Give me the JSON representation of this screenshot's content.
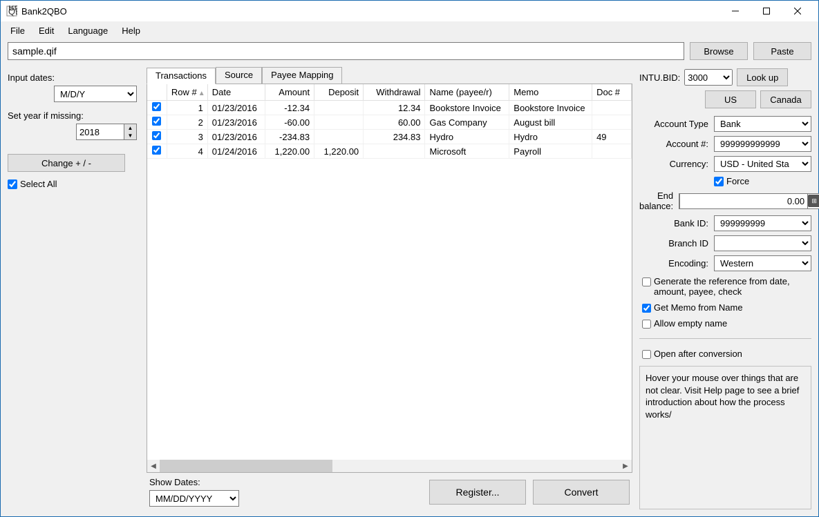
{
  "window": {
    "title": "Bank2QBO"
  },
  "menu": [
    "File",
    "Edit",
    "Language",
    "Help"
  ],
  "file_input": {
    "value": "sample.qif"
  },
  "buttons": {
    "browse": "Browse",
    "paste": "Paste",
    "lookup": "Look up",
    "us": "US",
    "canada": "Canada",
    "change": "Change + / -",
    "register": "Register...",
    "convert": "Convert"
  },
  "left": {
    "input_dates": "Input dates:",
    "date_format": "M/D/Y",
    "set_year": "Set year if missing:",
    "year": "2018",
    "select_all": "Select All"
  },
  "tabs": [
    "Transactions",
    "Source",
    "Payee Mapping"
  ],
  "columns": [
    "",
    "Row #",
    "Date",
    "Amount",
    "Deposit",
    "Withdrawal",
    "Name (payee/r)",
    "Memo",
    "Doc #"
  ],
  "rows": [
    {
      "chk": true,
      "row": "1",
      "date": "01/23/2016",
      "amount": "-12.34",
      "deposit": "",
      "withdrawal": "12.34",
      "name": "Bookstore Invoice",
      "memo": "Bookstore Invoice",
      "doc": ""
    },
    {
      "chk": true,
      "row": "2",
      "date": "01/23/2016",
      "amount": "-60.00",
      "deposit": "",
      "withdrawal": "60.00",
      "name": "Gas Company",
      "memo": "August bill",
      "doc": ""
    },
    {
      "chk": true,
      "row": "3",
      "date": "01/23/2016",
      "amount": "-234.83",
      "deposit": "",
      "withdrawal": "234.83",
      "name": "Hydro",
      "memo": "Hydro",
      "doc": "49"
    },
    {
      "chk": true,
      "row": "4",
      "date": "01/24/2016",
      "amount": "1,220.00",
      "deposit": "1,220.00",
      "withdrawal": "",
      "name": "Microsoft",
      "memo": "Payroll",
      "doc": ""
    }
  ],
  "show_dates": {
    "label": "Show Dates:",
    "value": "MM/DD/YYYY"
  },
  "right": {
    "intubid_label": "INTU.BID:",
    "intubid": "3000",
    "account_type_label": "Account Type",
    "account_type": "Bank",
    "account_num_label": "Account #:",
    "account_num": "999999999999",
    "currency_label": "Currency:",
    "currency": "USD - United Sta",
    "force": "Force",
    "end_balance_label": "End balance:",
    "end_balance": "0.00",
    "bank_id_label": "Bank ID:",
    "bank_id": "999999999",
    "branch_id_label": "Branch ID",
    "branch_id": "",
    "encoding_label": "Encoding:",
    "encoding": "Western",
    "gen_ref": "Generate the reference from date, amount, payee, check",
    "get_memo": "Get Memo from Name",
    "allow_empty": "Allow empty name",
    "open_after": "Open after conversion",
    "help": "Hover your mouse over things that are not clear. Visit Help page to see a brief introduction about how the process works/"
  }
}
